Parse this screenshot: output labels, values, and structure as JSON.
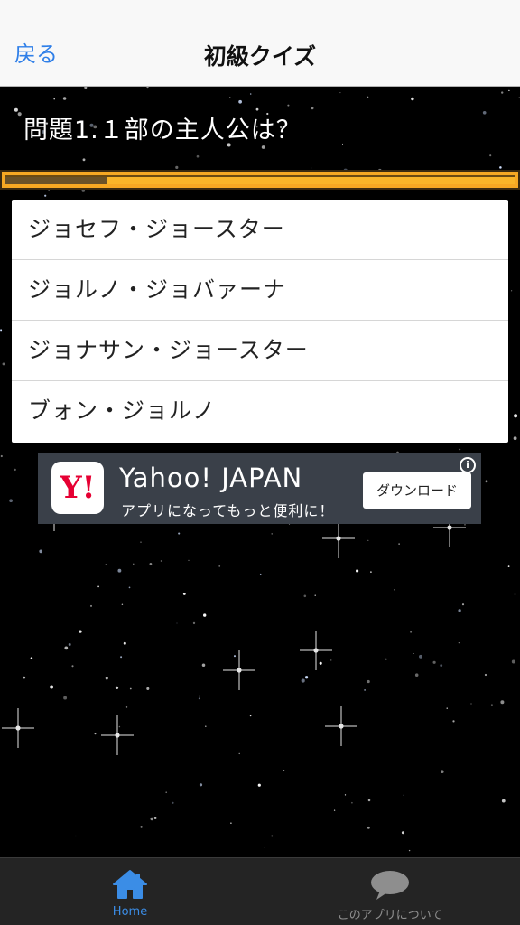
{
  "navbar": {
    "back_label": "戻る",
    "title": "初級クイズ"
  },
  "quiz": {
    "question": "問題1.１部の主人公は？",
    "progress": 0.2,
    "answers": [
      "ジョセフ・ジョースター",
      "ジョルノ・ジョバァーナ",
      "ジョナサン・ジョースター",
      "ブォン・ジョルノ"
    ]
  },
  "ad": {
    "logo_text": "Y!",
    "title": "Yahoo! JAPAN",
    "subtitle": "アプリになってもっと便利に！",
    "button_label": "ダウンロード",
    "info_label": "i"
  },
  "tabbar": {
    "items": [
      {
        "label": "Home",
        "icon": "home-icon",
        "active": true
      },
      {
        "label": "このアプリについて",
        "icon": "speech-bubble-icon",
        "active": false
      }
    ]
  },
  "colors": {
    "accent_blue": "#2f7fe8",
    "progress_orange": "#f6a823",
    "ad_logo_red": "#e60033"
  }
}
